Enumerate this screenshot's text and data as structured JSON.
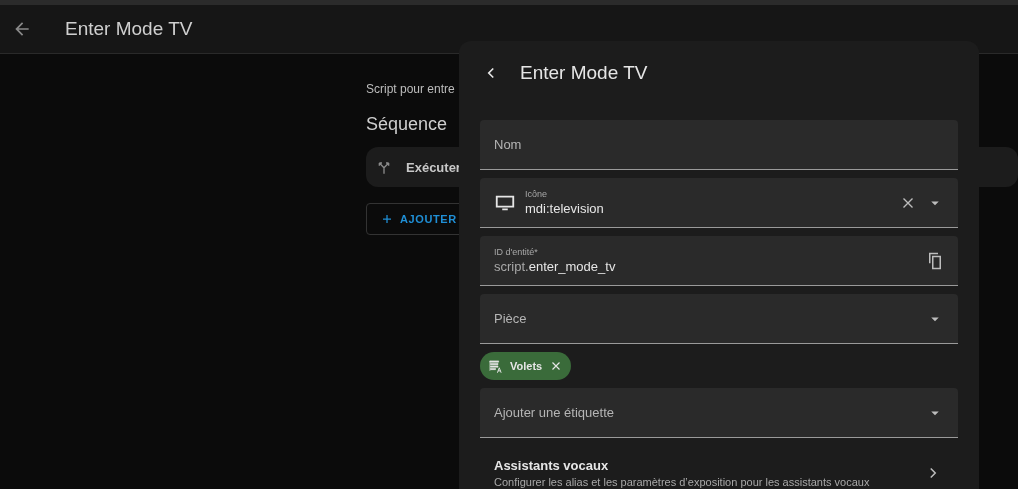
{
  "header": {
    "title": "Enter Mode TV"
  },
  "page": {
    "description": "Script pour entre",
    "section_title": "Séquence",
    "action": {
      "label": "Exécuter"
    },
    "add_button": {
      "label": "AJOUTER"
    }
  },
  "dialog": {
    "title": "Enter Mode TV",
    "fields": [
      {
        "kind": "text",
        "label": "Nom"
      },
      {
        "kind": "icon",
        "label": "Icône",
        "value": "mdi:television"
      },
      {
        "kind": "entity",
        "label": "ID d'entité*",
        "prefix": "script.",
        "value": "enter_mode_tv"
      },
      {
        "kind": "select",
        "label": "Pièce"
      },
      {
        "kind": "chip",
        "label": "Volets",
        "color": "#3a6b3a"
      },
      {
        "kind": "select",
        "label": "Ajouter une étiquette"
      }
    ],
    "link_row": {
      "title": "Assistants vocaux",
      "description": "Configurer les alias et les paramètres d’exposition pour les assistants vocaux"
    }
  }
}
